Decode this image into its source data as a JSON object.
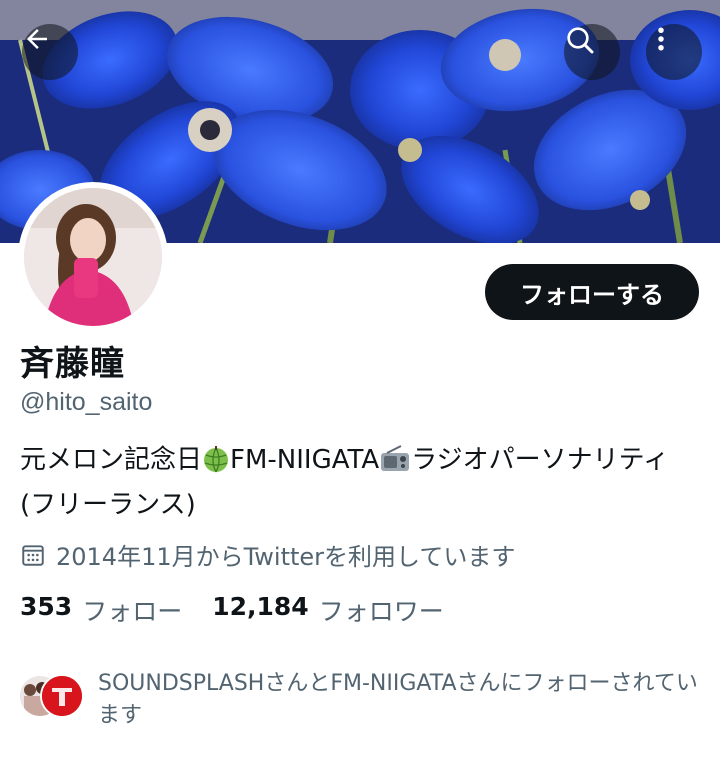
{
  "header": {
    "back_icon": "arrow-left-icon",
    "search_icon": "search-icon",
    "more_icon": "more-vertical-icon"
  },
  "profile": {
    "name": "斉藤瞳",
    "handle": "@hito_saito",
    "follow_label": "フォローする",
    "bio": {
      "part1": "元メロン記念日",
      "emoji1": "melon-emoji",
      "part2": "FM-NIIGATA",
      "emoji2": "radio-emoji",
      "part3": "ラジオパーソナリティ (フリーランス)"
    },
    "joined_icon": "calendar-icon",
    "joined": "2014年11月からTwitterを利用しています"
  },
  "stats": {
    "following_count": "353",
    "following_label": "フォロー",
    "followers_count": "12,184",
    "followers_label": "フォロワー"
  },
  "followed_by": {
    "text": "SOUNDSPLASHさんとFM-NIIGATAさんにフォローされています"
  },
  "colors": {
    "banner_blue": "#1e3fb8",
    "primary_text": "#0f1419",
    "secondary_text": "#536471",
    "button_bg": "#0f1419"
  }
}
